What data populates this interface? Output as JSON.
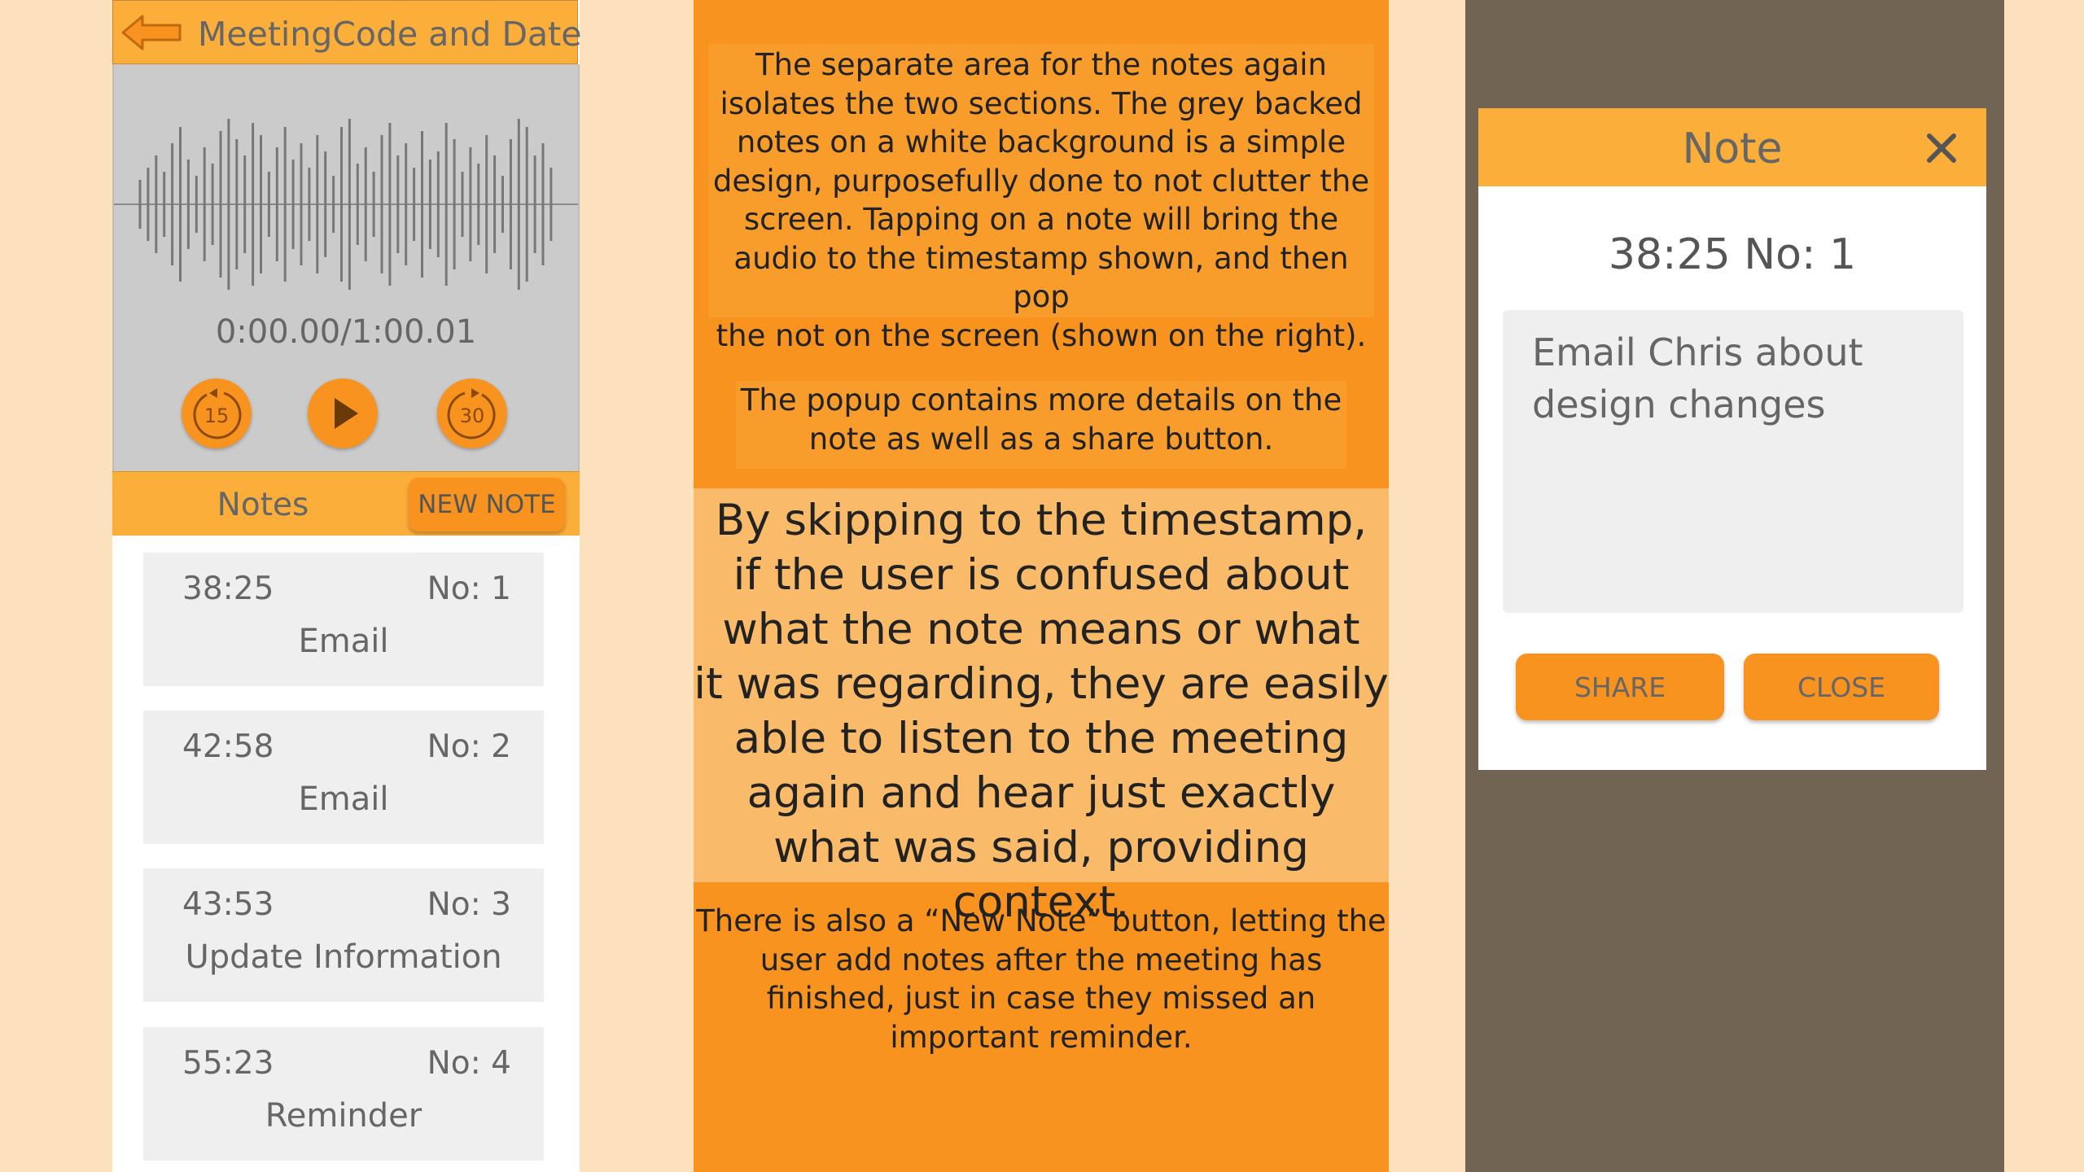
{
  "left_app": {
    "header_title": "MeetingCode and Date",
    "player": {
      "time_readout": "0:00.00/1:00.01",
      "skip_back_seconds": "15",
      "skip_forward_seconds": "30"
    },
    "notes_bar": {
      "label": "Notes",
      "new_note_button": "NEW NOTE"
    },
    "notes": [
      {
        "time": "38:25",
        "number": "No: 1",
        "title": "Email"
      },
      {
        "time": "42:58",
        "number": "No: 2",
        "title": "Email"
      },
      {
        "time": "43:53",
        "number": "No: 3",
        "title": "Update Information"
      },
      {
        "time": "55:23",
        "number": "No: 4",
        "title": "Reminder"
      }
    ]
  },
  "description": {
    "paragraph_1_lines": [
      "The separate area for the notes again",
      "isolates the two sections. The grey backed",
      "notes on a white background is a simple",
      "design, purposefully done to not clutter the",
      "screen. Tapping on a note will bring the",
      "audio to the timestamp shown, and then pop",
      "the not on the screen (shown on the right)."
    ],
    "paragraph_2_lines": [
      "The popup contains more details on the",
      "note as well as a share button."
    ],
    "quote_lines": [
      "By skipping to the timestamp,",
      "if the user is confused about",
      "what the note means or what",
      "it was regarding, they are easily",
      "able to listen to the meeting",
      "again and hear just exactly",
      "what was said, providing context."
    ],
    "paragraph_3_lines": [
      "There is also a “New Note” button, letting the",
      "user add notes after the meeting has",
      "finished, just in case they missed an",
      "important reminder."
    ]
  },
  "note_popup": {
    "title": "Note",
    "meta": "38:25 No: 1",
    "text_lines": [
      "Email Chris about",
      "design changes"
    ],
    "share_button": "SHARE",
    "close_button": "CLOSE"
  },
  "colors": {
    "page_background": "#fde1bd",
    "orange_header": "#fbae3a",
    "orange_accent": "#f7931e",
    "light_orange": "#f9bb6a",
    "player_grey": "#cbcbcb",
    "card_grey": "#efefef",
    "dark_backdrop": "#726453"
  },
  "icons": [
    "back-arrow-icon",
    "replay-15-icon",
    "play-icon",
    "forward-30-icon",
    "close-x-icon"
  ]
}
